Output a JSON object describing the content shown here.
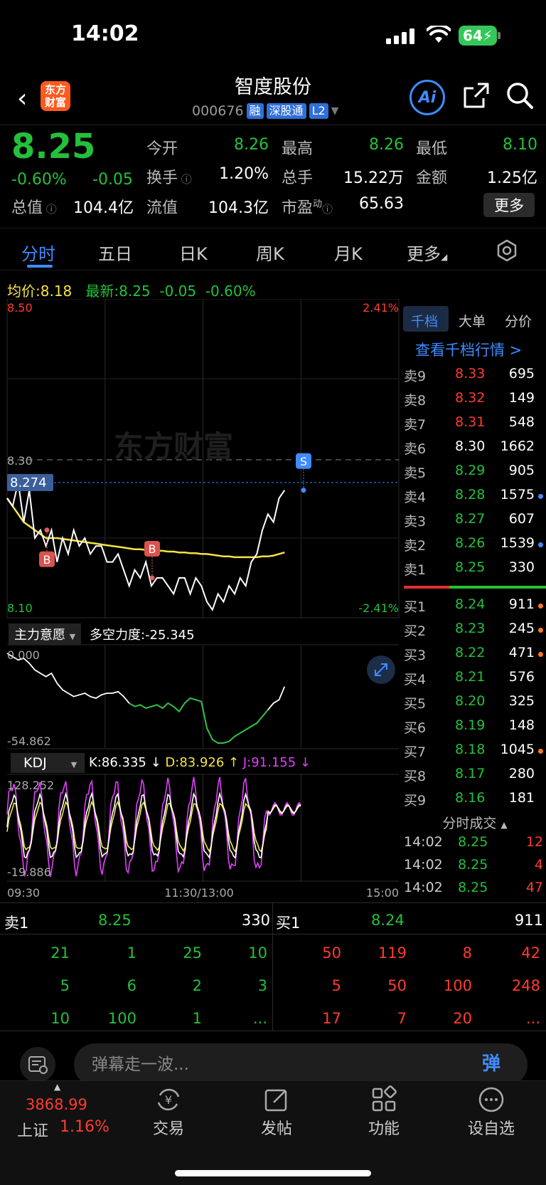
{
  "status_bar": {
    "time": "14:02",
    "battery": "64"
  },
  "header": {
    "logo": "东方财富",
    "name": "智度股份",
    "code": "000676",
    "tags": [
      "融",
      "深股通",
      "L2"
    ],
    "ai_label": "Ai"
  },
  "quote": {
    "price": "8.25",
    "change_pct": "-0.60%",
    "change_abs": "-0.05",
    "fields": [
      {
        "label": "今开",
        "value": "8.26",
        "color": "green"
      },
      {
        "label": "最高",
        "value": "8.26",
        "color": "green"
      },
      {
        "label": "最低",
        "value": "8.10",
        "color": "green"
      },
      {
        "label": "换手",
        "value": "1.20%",
        "color": "white"
      },
      {
        "label": "总手",
        "value": "15.22万",
        "color": "white"
      },
      {
        "label": "金额",
        "value": "1.25亿",
        "color": "white"
      },
      {
        "label": "总值",
        "value": "104.4亿",
        "color": "white"
      },
      {
        "label": "流值",
        "value": "104.3亿",
        "color": "white"
      },
      {
        "label": "市盈",
        "value": "65.63",
        "color": "white"
      }
    ],
    "pe_superscript": "动",
    "more_label": "更多"
  },
  "tabs": [
    "分时",
    "五日",
    "日K",
    "周K",
    "月K",
    "更多"
  ],
  "avg_line": {
    "avg_label": "均价:",
    "avg_value": "8.18",
    "latest_label": "最新:",
    "latest_value": "8.25",
    "chg_abs": "-0.05",
    "chg_pct": "-0.60%"
  },
  "chart_data": {
    "type": "line",
    "y_top": "8.50",
    "y_bottom": "8.10",
    "pct_top": "2.41%",
    "pct_bottom": "-2.41%",
    "ref_price": "8.30",
    "crosshair_price": "8.274",
    "watermark": "东方财富",
    "x_labels": [
      "09:30",
      "11:30/13:00",
      "15:00"
    ],
    "price_series": [
      8.25,
      8.24,
      8.27,
      8.22,
      8.26,
      8.2,
      8.21,
      8.19,
      8.21,
      8.17,
      8.2,
      8.18,
      8.21,
      8.19,
      8.2,
      8.18,
      8.19,
      8.19,
      8.17,
      8.17,
      8.18,
      8.16,
      8.14,
      8.16,
      8.15,
      8.17,
      8.14,
      8.15,
      8.15,
      8.14,
      8.13,
      8.15,
      8.15,
      8.13,
      8.15,
      8.14,
      8.12,
      8.11,
      8.13,
      8.12,
      8.14,
      8.13,
      8.15,
      8.14,
      8.17,
      8.18,
      8.21,
      8.23,
      8.22,
      8.25,
      8.26
    ],
    "avg_series": [
      8.25,
      8.24,
      8.23,
      8.22,
      8.215,
      8.21,
      8.205,
      8.2,
      8.2,
      8.2,
      8.199,
      8.198,
      8.197,
      8.196,
      8.195,
      8.194,
      8.193,
      8.192,
      8.191,
      8.19,
      8.189,
      8.188,
      8.187,
      8.186,
      8.186,
      8.185,
      8.185,
      8.184,
      8.184,
      8.183,
      8.183,
      8.182,
      8.182,
      8.181,
      8.181,
      8.18,
      8.18,
      8.179,
      8.178,
      8.177,
      8.177,
      8.176,
      8.176,
      8.176,
      8.176,
      8.176,
      8.177,
      8.177,
      8.178,
      8.18,
      8.182
    ],
    "buy_marks": [
      "B",
      "B"
    ],
    "sell_marks": [
      "S"
    ],
    "indicator": {
      "name": "主力意愿",
      "text": "多空力度:-25.345",
      "top": "0.000",
      "bottom": "-54.862",
      "series": [
        0,
        -2,
        -4,
        -3,
        -6,
        -10,
        -12,
        -14,
        -12,
        -18,
        -22,
        -24,
        -26,
        -25,
        -24,
        -26,
        -27,
        -25,
        -24,
        -24,
        -23,
        -26,
        -30,
        -32,
        -31,
        -33,
        -32,
        -31,
        -33,
        -30,
        -32,
        -35,
        -30,
        -27,
        -28,
        -29,
        -45,
        -52,
        -54,
        -54,
        -53,
        -50,
        -48,
        -46,
        -44,
        -42,
        -38,
        -34,
        -30,
        -28,
        -20
      ]
    },
    "kdj": {
      "name": "KDJ",
      "k": "K:86.335 ↓",
      "d": "D:83.926 ↑",
      "j": "J:91.155 ↓",
      "top": "128.252",
      "bottom": "-19.886"
    }
  },
  "order_book": {
    "tabs": [
      "千档",
      "大单",
      "分价"
    ],
    "view_label": "查看千档行情 >",
    "asks": [
      {
        "label": "卖9",
        "price": "8.33",
        "vol": "695",
        "pc": "red",
        "dot": ""
      },
      {
        "label": "卖8",
        "price": "8.32",
        "vol": "149",
        "pc": "red",
        "dot": ""
      },
      {
        "label": "卖7",
        "price": "8.31",
        "vol": "548",
        "pc": "red",
        "dot": ""
      },
      {
        "label": "卖6",
        "price": "8.30",
        "vol": "1662",
        "pc": "white",
        "dot": ""
      },
      {
        "label": "卖5",
        "price": "8.29",
        "vol": "905",
        "pc": "green",
        "dot": ""
      },
      {
        "label": "卖4",
        "price": "8.28",
        "vol": "1575",
        "pc": "green",
        "dot": "#3f8cff"
      },
      {
        "label": "卖3",
        "price": "8.27",
        "vol": "607",
        "pc": "green",
        "dot": ""
      },
      {
        "label": "卖2",
        "price": "8.26",
        "vol": "1539",
        "pc": "green",
        "dot": "#3f8cff"
      },
      {
        "label": "卖1",
        "price": "8.25",
        "vol": "330",
        "pc": "green",
        "dot": ""
      }
    ],
    "bids": [
      {
        "label": "买1",
        "price": "8.24",
        "vol": "911",
        "pc": "green",
        "dot": "#ff7a1a"
      },
      {
        "label": "买2",
        "price": "8.23",
        "vol": "245",
        "pc": "green",
        "dot": "#ff7a1a"
      },
      {
        "label": "买3",
        "price": "8.22",
        "vol": "471",
        "pc": "green",
        "dot": "#ff7a1a"
      },
      {
        "label": "买4",
        "price": "8.21",
        "vol": "576",
        "pc": "green",
        "dot": ""
      },
      {
        "label": "买5",
        "price": "8.20",
        "vol": "325",
        "pc": "green",
        "dot": ""
      },
      {
        "label": "买6",
        "price": "8.19",
        "vol": "148",
        "pc": "green",
        "dot": ""
      },
      {
        "label": "买7",
        "price": "8.18",
        "vol": "1045",
        "pc": "green",
        "dot": "#ff7a1a"
      },
      {
        "label": "买8",
        "price": "8.17",
        "vol": "280",
        "pc": "green",
        "dot": ""
      },
      {
        "label": "买9",
        "price": "8.16",
        "vol": "181",
        "pc": "green",
        "dot": ""
      }
    ],
    "ticks_title": "分时成交",
    "ticks": [
      {
        "time": "14:02",
        "price": "8.25",
        "vol": "12"
      },
      {
        "time": "14:02",
        "price": "8.25",
        "vol": "4"
      },
      {
        "time": "14:02",
        "price": "8.25",
        "vol": "47"
      }
    ]
  },
  "level_grid": {
    "sell_label": "卖1",
    "sell_price": "8.25",
    "sell_vol": "330",
    "buy_label": "买1",
    "buy_price": "8.24",
    "buy_vol": "911",
    "sell_rows": [
      [
        "21",
        "1",
        "25",
        "10"
      ],
      [
        "5",
        "6",
        "2",
        "3"
      ],
      [
        "10",
        "100",
        "1",
        "..."
      ]
    ],
    "buy_rows": [
      [
        "50",
        "119",
        "8",
        "42"
      ],
      [
        "5",
        "50",
        "100",
        "248"
      ],
      [
        "17",
        "7",
        "20",
        "..."
      ]
    ]
  },
  "danmaku": {
    "placeholder": "弹幕走一波...",
    "button": "弹"
  },
  "bottom_nav": {
    "index_value": "3868.99",
    "index_name": "上证",
    "index_pct": "1.16%",
    "items": [
      "交易",
      "发帖",
      "功能",
      "设自选"
    ]
  }
}
